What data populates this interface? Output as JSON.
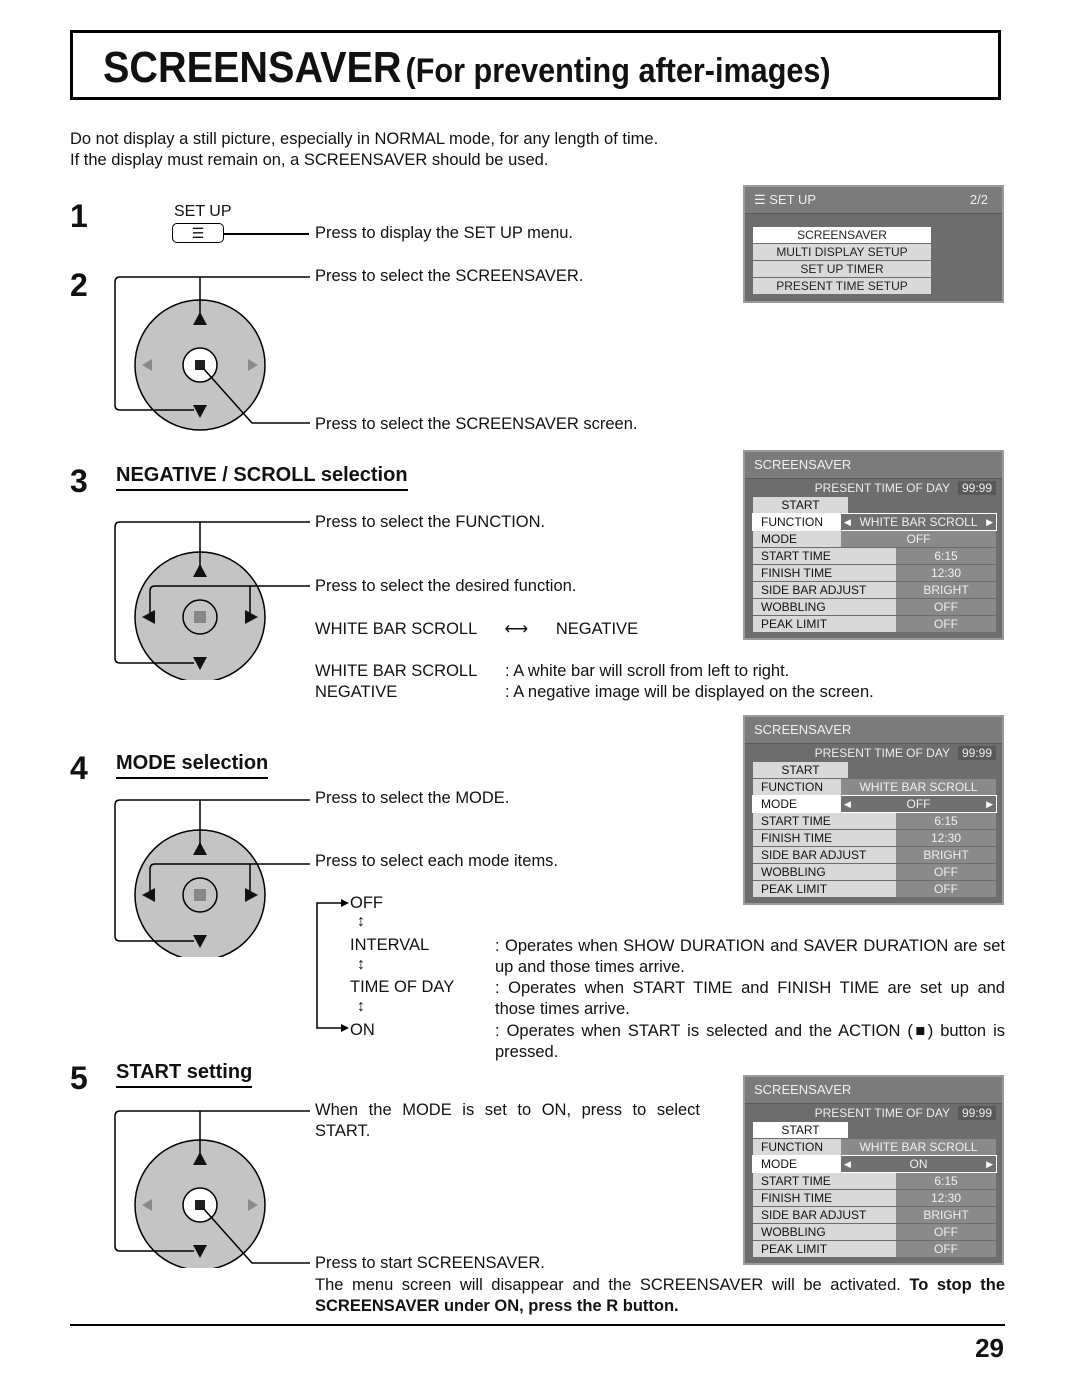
{
  "header": {
    "title_main": "SCREENSAVER",
    "title_sub": "(For preventing after-images)"
  },
  "intro": [
    "Do not display a still picture, especially in NORMAL mode, for any length of time.",
    "If the display must remain on, a SCREENSAVER should be used."
  ],
  "steps": {
    "s1": {
      "num": "1",
      "button_label": "SET UP",
      "text": "Press to display the SET UP menu."
    },
    "s2": {
      "num": "2",
      "text_up": "Press to select the SCREENSAVER.",
      "text_action": "Press to select the SCREENSAVER screen."
    },
    "s3": {
      "num": "3",
      "heading": "NEGATIVE / SCROLL selection",
      "text_up": "Press to select the FUNCTION.",
      "text_lr": "Press to select the desired function.",
      "toggle_a": "WHITE BAR SCROLL",
      "toggle_b": "NEGATIVE",
      "defs": [
        {
          "term": "WHITE BAR SCROLL",
          "desc": ": A white bar will scroll from left to right."
        },
        {
          "term": "NEGATIVE",
          "desc": ": A negative image will be displayed on the screen."
        }
      ]
    },
    "s4": {
      "num": "4",
      "heading": "MODE selection",
      "text_up": "Press to select the MODE.",
      "text_lr": "Press to select each mode items.",
      "modes": [
        {
          "term": "OFF",
          "desc": ""
        },
        {
          "term": "INTERVAL",
          "desc": ": Operates when SHOW DURATION and SAVER DURATION are set up and those times arrive."
        },
        {
          "term": "TIME OF DAY",
          "desc": ": Operates when START TIME and FINISH TIME are set up and those times arrive."
        },
        {
          "term": "ON",
          "desc": ": Operates when START is selected and the ACTION (■) button is pressed."
        }
      ]
    },
    "s5": {
      "num": "5",
      "heading": "START setting",
      "text_up": "When the MODE is set to ON, press to select START.",
      "text_action": "Press to start SCREENSAVER.",
      "note_plain": "The menu screen will disappear and the SCREENSAVER will be activated. ",
      "note_bold": "To stop the SCREENSAVER under ON, press the R button."
    }
  },
  "osd_setup": {
    "title": "SET UP",
    "page": "2/2",
    "icon": "menu-list-icon",
    "items": [
      "SCREENSAVER",
      "MULTI DISPLAY SETUP",
      "SET UP TIMER",
      "PRESENT TIME SETUP"
    ],
    "selected": 0
  },
  "osd_screensaver": {
    "title": "SCREENSAVER",
    "present_time_label": "PRESENT  TIME OF DAY",
    "present_time_value": "99:99",
    "start_label": "START",
    "rows": [
      {
        "label": "FUNCTION",
        "value": "WHITE BAR SCROLL"
      },
      {
        "label": "MODE",
        "value": "OFF"
      },
      {
        "label": "START TIME",
        "value": "6:15"
      },
      {
        "label": "FINISH TIME",
        "value": "12:30"
      },
      {
        "label": "SIDE BAR ADJUST",
        "value": "BRIGHT"
      },
      {
        "label": "WOBBLING",
        "value": "OFF"
      },
      {
        "label": "PEAK LIMIT",
        "value": "OFF"
      }
    ],
    "mode_on_value": "ON"
  },
  "colors": {
    "osd_bg": "#6d6d6d",
    "osd_row": "#d9d9d9",
    "osd_value": "#8a8a8a",
    "remote_gray": "#c4c4c4"
  },
  "page_number": "29"
}
